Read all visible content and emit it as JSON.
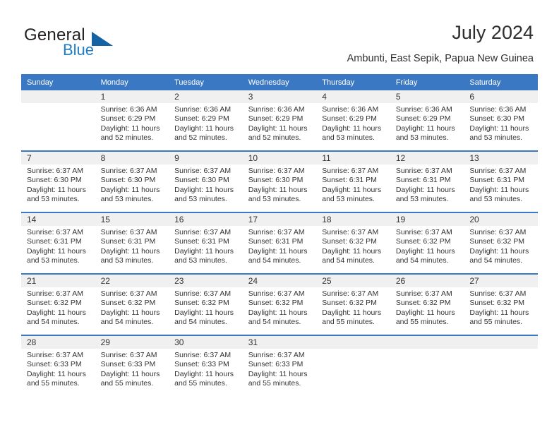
{
  "brand": {
    "name_part1": "General",
    "name_part2": "Blue",
    "flag_icon": "triangle-flag-icon"
  },
  "header": {
    "title": "July 2024",
    "location": "Ambunti, East Sepik, Papua New Guinea"
  },
  "colors": {
    "header_blue": "#3b78c3",
    "logo_blue": "#1f7dc4",
    "day_band": "#f0f0f0"
  },
  "weekday_headers": [
    "Sunday",
    "Monday",
    "Tuesday",
    "Wednesday",
    "Thursday",
    "Friday",
    "Saturday"
  ],
  "labels": {
    "sunrise": "Sunrise:",
    "sunset": "Sunset:",
    "daylight": "Daylight:"
  },
  "weeks": [
    [
      {
        "day": "",
        "empty": true,
        "l1": "",
        "l2": "",
        "l3": "",
        "l4": ""
      },
      {
        "day": "1",
        "l1": "Sunrise: 6:36 AM",
        "l2": "Sunset: 6:29 PM",
        "l3": "Daylight: 11 hours",
        "l4": "and 52 minutes."
      },
      {
        "day": "2",
        "l1": "Sunrise: 6:36 AM",
        "l2": "Sunset: 6:29 PM",
        "l3": "Daylight: 11 hours",
        "l4": "and 52 minutes."
      },
      {
        "day": "3",
        "l1": "Sunrise: 6:36 AM",
        "l2": "Sunset: 6:29 PM",
        "l3": "Daylight: 11 hours",
        "l4": "and 52 minutes."
      },
      {
        "day": "4",
        "l1": "Sunrise: 6:36 AM",
        "l2": "Sunset: 6:29 PM",
        "l3": "Daylight: 11 hours",
        "l4": "and 53 minutes."
      },
      {
        "day": "5",
        "l1": "Sunrise: 6:36 AM",
        "l2": "Sunset: 6:29 PM",
        "l3": "Daylight: 11 hours",
        "l4": "and 53 minutes."
      },
      {
        "day": "6",
        "l1": "Sunrise: 6:36 AM",
        "l2": "Sunset: 6:30 PM",
        "l3": "Daylight: 11 hours",
        "l4": "and 53 minutes."
      }
    ],
    [
      {
        "day": "7",
        "l1": "Sunrise: 6:37 AM",
        "l2": "Sunset: 6:30 PM",
        "l3": "Daylight: 11 hours",
        "l4": "and 53 minutes."
      },
      {
        "day": "8",
        "l1": "Sunrise: 6:37 AM",
        "l2": "Sunset: 6:30 PM",
        "l3": "Daylight: 11 hours",
        "l4": "and 53 minutes."
      },
      {
        "day": "9",
        "l1": "Sunrise: 6:37 AM",
        "l2": "Sunset: 6:30 PM",
        "l3": "Daylight: 11 hours",
        "l4": "and 53 minutes."
      },
      {
        "day": "10",
        "l1": "Sunrise: 6:37 AM",
        "l2": "Sunset: 6:30 PM",
        "l3": "Daylight: 11 hours",
        "l4": "and 53 minutes."
      },
      {
        "day": "11",
        "l1": "Sunrise: 6:37 AM",
        "l2": "Sunset: 6:31 PM",
        "l3": "Daylight: 11 hours",
        "l4": "and 53 minutes."
      },
      {
        "day": "12",
        "l1": "Sunrise: 6:37 AM",
        "l2": "Sunset: 6:31 PM",
        "l3": "Daylight: 11 hours",
        "l4": "and 53 minutes."
      },
      {
        "day": "13",
        "l1": "Sunrise: 6:37 AM",
        "l2": "Sunset: 6:31 PM",
        "l3": "Daylight: 11 hours",
        "l4": "and 53 minutes."
      }
    ],
    [
      {
        "day": "14",
        "l1": "Sunrise: 6:37 AM",
        "l2": "Sunset: 6:31 PM",
        "l3": "Daylight: 11 hours",
        "l4": "and 53 minutes."
      },
      {
        "day": "15",
        "l1": "Sunrise: 6:37 AM",
        "l2": "Sunset: 6:31 PM",
        "l3": "Daylight: 11 hours",
        "l4": "and 53 minutes."
      },
      {
        "day": "16",
        "l1": "Sunrise: 6:37 AM",
        "l2": "Sunset: 6:31 PM",
        "l3": "Daylight: 11 hours",
        "l4": "and 53 minutes."
      },
      {
        "day": "17",
        "l1": "Sunrise: 6:37 AM",
        "l2": "Sunset: 6:31 PM",
        "l3": "Daylight: 11 hours",
        "l4": "and 54 minutes."
      },
      {
        "day": "18",
        "l1": "Sunrise: 6:37 AM",
        "l2": "Sunset: 6:32 PM",
        "l3": "Daylight: 11 hours",
        "l4": "and 54 minutes."
      },
      {
        "day": "19",
        "l1": "Sunrise: 6:37 AM",
        "l2": "Sunset: 6:32 PM",
        "l3": "Daylight: 11 hours",
        "l4": "and 54 minutes."
      },
      {
        "day": "20",
        "l1": "Sunrise: 6:37 AM",
        "l2": "Sunset: 6:32 PM",
        "l3": "Daylight: 11 hours",
        "l4": "and 54 minutes."
      }
    ],
    [
      {
        "day": "21",
        "l1": "Sunrise: 6:37 AM",
        "l2": "Sunset: 6:32 PM",
        "l3": "Daylight: 11 hours",
        "l4": "and 54 minutes."
      },
      {
        "day": "22",
        "l1": "Sunrise: 6:37 AM",
        "l2": "Sunset: 6:32 PM",
        "l3": "Daylight: 11 hours",
        "l4": "and 54 minutes."
      },
      {
        "day": "23",
        "l1": "Sunrise: 6:37 AM",
        "l2": "Sunset: 6:32 PM",
        "l3": "Daylight: 11 hours",
        "l4": "and 54 minutes."
      },
      {
        "day": "24",
        "l1": "Sunrise: 6:37 AM",
        "l2": "Sunset: 6:32 PM",
        "l3": "Daylight: 11 hours",
        "l4": "and 54 minutes."
      },
      {
        "day": "25",
        "l1": "Sunrise: 6:37 AM",
        "l2": "Sunset: 6:32 PM",
        "l3": "Daylight: 11 hours",
        "l4": "and 55 minutes."
      },
      {
        "day": "26",
        "l1": "Sunrise: 6:37 AM",
        "l2": "Sunset: 6:32 PM",
        "l3": "Daylight: 11 hours",
        "l4": "and 55 minutes."
      },
      {
        "day": "27",
        "l1": "Sunrise: 6:37 AM",
        "l2": "Sunset: 6:32 PM",
        "l3": "Daylight: 11 hours",
        "l4": "and 55 minutes."
      }
    ],
    [
      {
        "day": "28",
        "l1": "Sunrise: 6:37 AM",
        "l2": "Sunset: 6:33 PM",
        "l3": "Daylight: 11 hours",
        "l4": "and 55 minutes."
      },
      {
        "day": "29",
        "l1": "Sunrise: 6:37 AM",
        "l2": "Sunset: 6:33 PM",
        "l3": "Daylight: 11 hours",
        "l4": "and 55 minutes."
      },
      {
        "day": "30",
        "l1": "Sunrise: 6:37 AM",
        "l2": "Sunset: 6:33 PM",
        "l3": "Daylight: 11 hours",
        "l4": "and 55 minutes."
      },
      {
        "day": "31",
        "l1": "Sunrise: 6:37 AM",
        "l2": "Sunset: 6:33 PM",
        "l3": "Daylight: 11 hours",
        "l4": "and 55 minutes."
      },
      {
        "day": "",
        "empty": true,
        "l1": "",
        "l2": "",
        "l3": "",
        "l4": ""
      },
      {
        "day": "",
        "empty": true,
        "l1": "",
        "l2": "",
        "l3": "",
        "l4": ""
      },
      {
        "day": "",
        "empty": true,
        "l1": "",
        "l2": "",
        "l3": "",
        "l4": ""
      }
    ]
  ]
}
